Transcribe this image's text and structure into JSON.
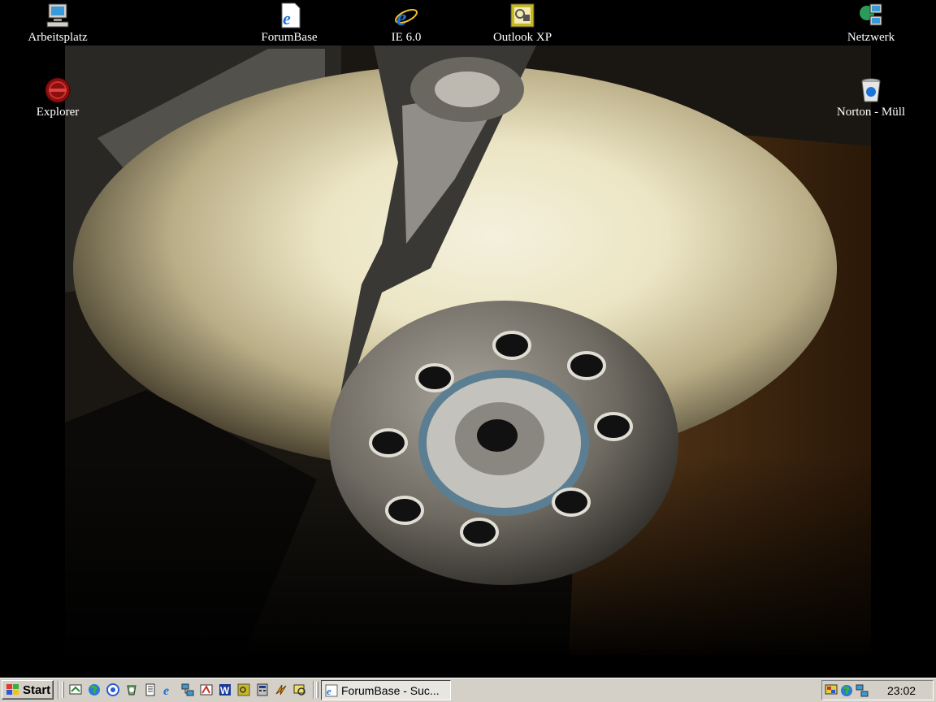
{
  "desktop": {
    "icons": {
      "arbeitsplatz": "Arbeitsplatz",
      "forumbase": "ForumBase",
      "ie": "IE 6.0",
      "outlook": "Outlook XP",
      "netzwerk": "Netzwerk",
      "explorer": "Explorer",
      "norton": "Norton - Müll"
    }
  },
  "taskbar": {
    "start_label": "Start",
    "quicklaunch_icons": [
      "desktop-icon",
      "globe-icon",
      "search-icon",
      "recycle-icon",
      "notepad-icon",
      "ie-icon",
      "network-icon",
      "paint-icon",
      "word-icon",
      "outlook-icon",
      "calc-icon",
      "winamp-icon",
      "viewer-icon"
    ],
    "task_button_label": "ForumBase - Suc...",
    "tray_icons": [
      "display-icon",
      "globe-icon",
      "network-icon"
    ],
    "clock": "23:02"
  },
  "colors": {
    "taskbar": "#d4d0c8",
    "desktop": "#000000",
    "label_text": "#ffffff"
  }
}
